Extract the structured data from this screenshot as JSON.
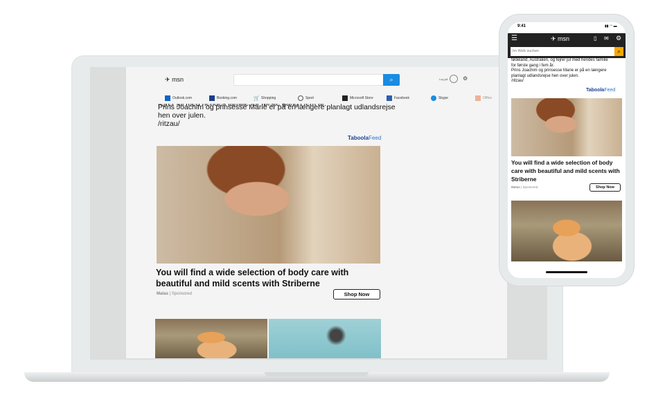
{
  "laptop": {
    "header": {
      "logo": "msn",
      "search_placeholder": "",
      "sign_in": "Log på"
    },
    "nav": [
      "Outlook.com",
      "Booking.com",
      "Shopping",
      "Sport",
      "Microsoft Store",
      "Facebook",
      "Skype",
      "Office"
    ],
    "article": {
      "lines": [
        "fejrer jul med hendes familie for første gang i fem år.",
        "Prins Joachim og prinsesse Marie er på en længere planlagt udlandsrejse",
        "hen over julen.",
        "/ritzau/"
      ]
    },
    "taboola": {
      "brand": "Taboola",
      "feed": "Feed"
    },
    "ad": {
      "headline": "You will find a wide selection of body care with beautiful and mild scents with Striberne",
      "source": "Matas",
      "sponsored": "Sponsored",
      "cta": "Shop Now"
    }
  },
  "phone": {
    "time": "9:41",
    "header": {
      "logo": "msn",
      "search_placeholder": "Im Web suchen"
    },
    "article": {
      "lines": [
        "fødeland, Australien, og fejrer jul med hendes familie",
        "for første gang i fem år.",
        "Prins Joachim og prinsesse Marie er på en længere",
        "planlagt udlandsrejse hen over julen.",
        "/ritzau/"
      ]
    },
    "taboola": {
      "brand": "Taboola",
      "feed": "Feed"
    },
    "ad": {
      "headline": "You will find a wide selection of body care with beautiful and mild scents with Striberne",
      "source": "Matas",
      "sponsored": "Sponsored",
      "cta": "Shop Now"
    }
  },
  "colors": {
    "msn_blue": "#1a8ce2",
    "phone_search_accent": "#f5a800",
    "taboola": "#1a3f8f"
  }
}
